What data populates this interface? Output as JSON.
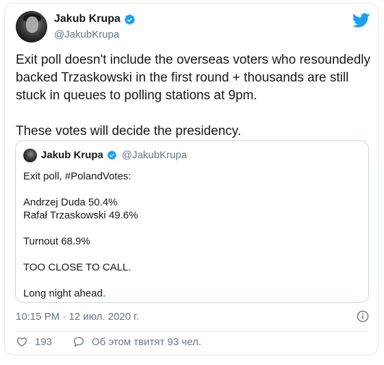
{
  "author": {
    "name": "Jakub Krupa",
    "handle": "@JakubKrupa"
  },
  "tweet": {
    "text": "Exit poll doesn't include the overseas voters who resoundedly backed Trzaskowski in the first round + thousands are still stuck in queues to polling stations at 9pm.\n\nThese votes will decide the presidency."
  },
  "quoted_tweet": {
    "name": "Jakub Krupa",
    "handle": "@JakubKrupa",
    "text": "Exit poll, #PolandVotes:\n\nAndrzej Duda 50.4%\nRafał Trzaskowski 49.6%\n\nTurnout 68.9%\n\nTOO CLOSE TO CALL.\n\nLong night ahead."
  },
  "meta": {
    "timestamp": "10:15 PM · 12 июл. 2020 г."
  },
  "actions": {
    "likes": "193",
    "talking_about": "Об этом твитят 93 чел."
  },
  "colors": {
    "twitter_blue": "#1da1f2",
    "secondary_text": "#657786",
    "border": "#e1e8ed"
  }
}
